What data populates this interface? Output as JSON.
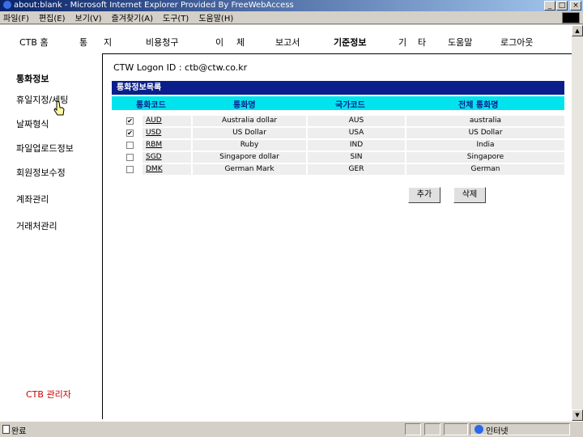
{
  "window": {
    "title": "about:blank - Microsoft Internet Explorer Provided By FreeWebAccess",
    "min_icon": "_",
    "max_icon": "□",
    "close_icon": "×"
  },
  "menubar": {
    "items": [
      "파일(F)",
      "편집(E)",
      "보기(V)",
      "즐겨찾기(A)",
      "도구(T)",
      "도움말(H)"
    ]
  },
  "topnav": {
    "home": "CTB 홈",
    "tong": "통",
    "ji": "지",
    "billing": "비용청구",
    "i": "이",
    "che": "체",
    "report": "보고서",
    "base_info": "기준정보",
    "gi": "기",
    "ta": "타",
    "help": "도움말",
    "logout": "로그아웃"
  },
  "sidebar": {
    "section": "통화정보",
    "items": [
      "휴일지정/세팅",
      "날짜형식",
      "파일업로드정보",
      "회원정보수정",
      "계좌관리",
      "거래처관리"
    ],
    "admin": "CTB 관리자"
  },
  "main": {
    "logon": "CTW Logon ID : ctb@ctw.co.kr",
    "list_title": "통화정보목록",
    "headers": [
      "통화코드",
      "통화명",
      "국가코드",
      "전체 통화명"
    ],
    "rows": [
      {
        "checked": "✔",
        "code": "AUD",
        "name": "Australia dollar",
        "country": "AUS",
        "full": "australia"
      },
      {
        "checked": "✔",
        "code": "USD",
        "name": "US Dollar",
        "country": "USA",
        "full": "US Dollar"
      },
      {
        "checked": "",
        "code": "RBM",
        "name": "Ruby",
        "country": "IND",
        "full": "India"
      },
      {
        "checked": "",
        "code": "SGD",
        "name": "Singapore dollar",
        "country": "SIN",
        "full": "Singapore"
      },
      {
        "checked": "",
        "code": "DMK",
        "name": "German Mark",
        "country": "GER",
        "full": "German"
      }
    ],
    "add_button": "추가",
    "delete_button": "삭제"
  },
  "statusbar": {
    "status": "완료",
    "zone": "인터넷"
  }
}
